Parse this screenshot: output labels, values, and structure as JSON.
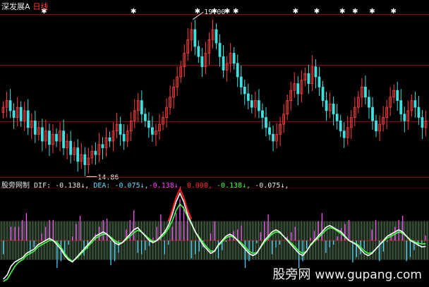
{
  "header": {
    "title": "深发展A",
    "period": "日线"
  },
  "price_high_label": "19.00",
  "price_low_label": "14.86",
  "indicator": {
    "name": "股旁网制",
    "dif_label": "DIF:",
    "dif_value": "-0.138↓,",
    "dea_label": "DEA:",
    "dea_value": "-0.075↓,",
    "v3": "-0.138↓,",
    "v4": "0.000,",
    "v5": "-0.138↓,",
    "v6": "-0.075↓,"
  },
  "watermark": {
    "site": "股旁网",
    "url": "www.gupang.com"
  },
  "colors": {
    "up": "#ff4040",
    "down": "#40e0e0",
    "grid": "#800000",
    "dif": "#ffffff",
    "dea": "#40ff40",
    "peak": "#ff2020"
  },
  "chart_data": [
    {
      "type": "candlestick",
      "title": "深发展A 日线",
      "annotations": [
        {
          "label": "19.00",
          "at": "high"
        },
        {
          "label": "14.86",
          "at": "low"
        }
      ],
      "close": [
        16.6,
        16.8,
        16.5,
        16.3,
        16.6,
        16.2,
        16.5,
        16.0,
        16.2,
        15.8,
        16.0,
        15.6,
        15.9,
        15.5,
        15.8,
        15.6,
        15.9,
        15.4,
        15.6,
        15.2,
        15.4,
        15.0,
        15.2,
        14.9,
        15.1,
        15.3,
        15.2,
        15.5,
        15.4,
        15.7,
        15.6,
        15.9,
        16.1,
        15.8,
        15.6,
        15.9,
        16.2,
        16.5,
        16.8,
        16.4,
        16.2,
        16.0,
        15.8,
        15.9,
        16.1,
        16.3,
        16.6,
        16.9,
        17.2,
        17.5,
        17.8,
        18.2,
        18.6,
        18.9,
        18.4,
        18.1,
        17.8,
        18.2,
        18.6,
        18.9,
        18.5,
        18.1,
        17.7,
        17.9,
        18.2,
        17.9,
        17.5,
        17.2,
        17.0,
        16.8,
        16.6,
        16.8,
        16.5,
        16.3,
        16.0,
        15.8,
        15.6,
        15.8,
        16.1,
        16.4,
        16.8,
        17.1,
        17.3,
        17.0,
        17.4,
        17.6,
        17.3,
        17.8,
        17.5,
        17.2,
        16.8,
        16.5,
        16.7,
        16.4,
        16.2,
        15.9,
        15.7,
        16.0,
        16.3,
        16.6,
        16.9,
        17.2,
        16.9,
        16.6,
        16.2,
        15.9,
        16.1,
        16.3,
        16.6,
        16.9,
        17.1,
        16.8,
        16.4,
        16.2,
        16.5,
        16.8,
        16.6,
        16.3,
        16.0,
        16.2
      ]
    },
    {
      "type": "line",
      "title": "股旁网制",
      "series": [
        {
          "name": "DIF",
          "values": [
            -0.9,
            -0.8,
            -0.6,
            -0.5,
            -0.45,
            -0.4,
            -0.3,
            -0.25,
            -0.2,
            -0.1,
            -0.05,
            0.0,
            0.05,
            0.0,
            -0.1,
            -0.2,
            -0.35,
            -0.45,
            -0.5,
            -0.4,
            -0.3,
            -0.2,
            -0.1,
            0.0,
            0.1,
            0.15,
            0.2,
            0.15,
            0.05,
            -0.05,
            -0.1,
            -0.05,
            0.05,
            0.15,
            0.25,
            0.3,
            0.2,
            0.1,
            0.0,
            -0.05,
            0.0,
            0.1,
            0.2,
            0.35,
            0.6,
            0.9,
            1.1,
            0.9,
            0.6,
            0.4,
            0.2,
            0.05,
            -0.1,
            -0.2,
            -0.3,
            -0.25,
            -0.1,
            0.0,
            0.1,
            0.15,
            0.1,
            0.0,
            -0.1,
            -0.2,
            -0.3,
            -0.35,
            -0.3,
            -0.15,
            0.0,
            0.1,
            0.2,
            0.25,
            0.2,
            0.1,
            0.0,
            -0.1,
            -0.2,
            -0.3,
            -0.35,
            -0.25,
            -0.1,
            0.0,
            0.1,
            0.2,
            0.3,
            0.35,
            0.3,
            0.25,
            0.2,
            0.1,
            0.0,
            -0.05,
            -0.1,
            -0.2,
            -0.3,
            -0.35,
            -0.3,
            -0.2,
            -0.1,
            0.0,
            0.1,
            0.15,
            0.2,
            0.25,
            0.2,
            0.1,
            0.0,
            -0.05,
            -0.1,
            -0.15,
            -0.138
          ]
        },
        {
          "name": "DEA",
          "values": [
            -0.95,
            -0.9,
            -0.75,
            -0.6,
            -0.5,
            -0.45,
            -0.35,
            -0.3,
            -0.25,
            -0.15,
            -0.1,
            -0.05,
            0.0,
            0.0,
            -0.05,
            -0.15,
            -0.3,
            -0.42,
            -0.48,
            -0.42,
            -0.33,
            -0.24,
            -0.14,
            -0.05,
            0.05,
            0.1,
            0.15,
            0.14,
            0.08,
            0.0,
            -0.06,
            -0.05,
            0.02,
            0.1,
            0.18,
            0.24,
            0.2,
            0.12,
            0.04,
            -0.02,
            0.0,
            0.06,
            0.15,
            0.28,
            0.45,
            0.7,
            0.85,
            0.75,
            0.55,
            0.38,
            0.2,
            0.08,
            -0.05,
            -0.15,
            -0.25,
            -0.24,
            -0.12,
            -0.03,
            0.06,
            0.1,
            0.08,
            0.02,
            -0.06,
            -0.15,
            -0.25,
            -0.3,
            -0.28,
            -0.16,
            -0.04,
            0.06,
            0.15,
            0.2,
            0.18,
            0.1,
            0.02,
            -0.06,
            -0.15,
            -0.25,
            -0.3,
            -0.24,
            -0.12,
            -0.02,
            0.06,
            0.15,
            0.24,
            0.3,
            0.28,
            0.22,
            0.16,
            0.08,
            0.0,
            -0.04,
            -0.08,
            -0.15,
            -0.24,
            -0.3,
            -0.28,
            -0.2,
            -0.1,
            -0.02,
            0.06,
            0.1,
            0.15,
            0.2,
            0.17,
            0.1,
            0.02,
            -0.03,
            -0.06,
            -0.08,
            -0.075
          ]
        }
      ]
    }
  ]
}
